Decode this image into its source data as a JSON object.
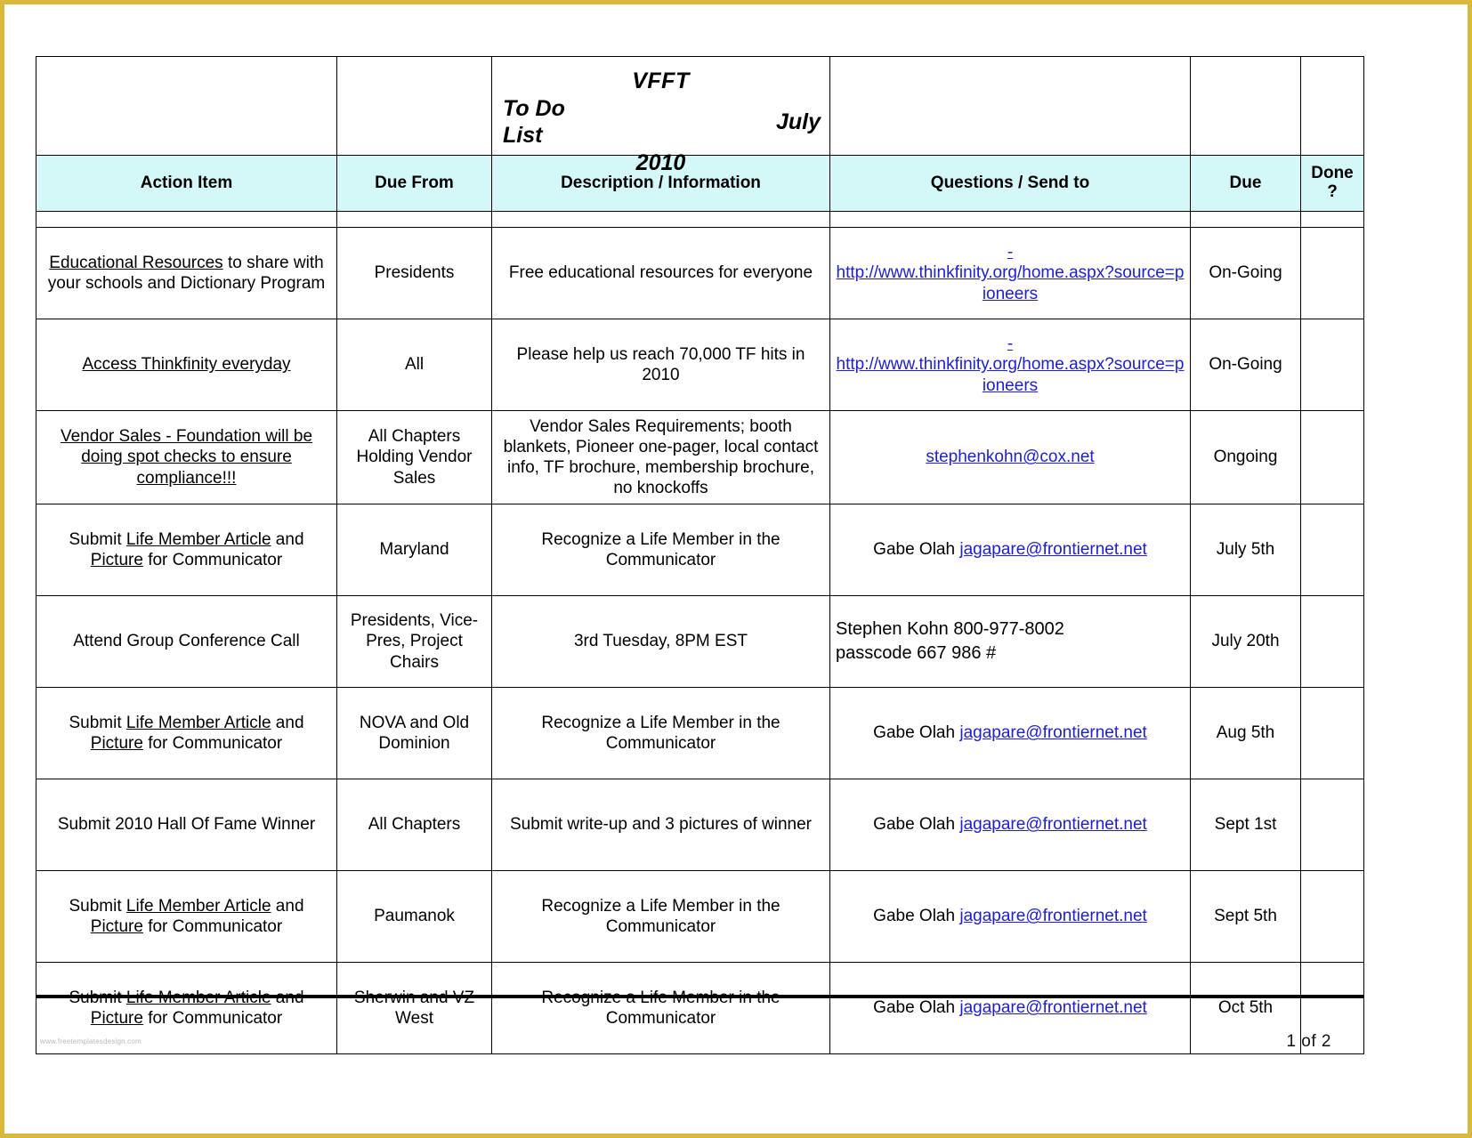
{
  "document": {
    "org": "VFFT",
    "doc_title": "To Do List",
    "month": "July",
    "year": "2010"
  },
  "columns": {
    "action_item": "Action Item",
    "due_from": "Due From",
    "description": "Description / Information",
    "questions": "Questions / Send to",
    "due": "Due",
    "done": "Done ?"
  },
  "links": {
    "thinkfinity_lead": "-",
    "thinkfinity_url": "http://www.thinkfinity.org/home.aspx?source=pioneers",
    "stephen_email": "stephenkohn@cox.net",
    "gabe_email": "jagapare@frontiernet.net"
  },
  "rows": [
    {
      "action_underlined": "Educational Resources",
      "action_rest": " to share with your schools and Dictionary Program",
      "due_from": "Presidents",
      "description": "Free educational resources for everyone",
      "questions_kind": "url",
      "questions_prefix": "",
      "due": "On-Going",
      "done": ""
    },
    {
      "action_underlined": "Access Thinkfinity everyday",
      "action_rest": "",
      "due_from": "All",
      "description": "Please help us reach 70,000 TF hits in 2010",
      "questions_kind": "url",
      "questions_prefix": "",
      "due": "On-Going",
      "done": ""
    },
    {
      "action_underlined": "Vendor Sales - Foundation will be doing spot checks to ensure compliance!!!",
      "action_rest": "",
      "due_from": "All Chapters Holding Vendor Sales",
      "description": "Vendor Sales Requirements; booth blankets, Pioneer one-pager, local contact info, TF brochure, membership brochure, no knockoffs",
      "questions_kind": "email-stephen",
      "questions_prefix": "",
      "due": "Ongoing",
      "done": ""
    },
    {
      "action_pre": "Submit ",
      "action_underlined": "Life Member Article",
      "action_mid": " and ",
      "action_underlined2": "Picture",
      "action_post": " for Communicator",
      "due_from": "Maryland",
      "description": "Recognize a Life Member in the Communicator",
      "questions_kind": "email-gabe",
      "questions_prefix": "Gabe Olah ",
      "due": "July 5th",
      "done": ""
    },
    {
      "action_plain": "Attend Group Conference Call",
      "due_from": "Presidents, Vice-Pres, Project Chairs",
      "description": "3rd Tuesday,  8PM EST",
      "questions_kind": "note",
      "questions_note_line1": "Stephen Kohn  800-977-8002",
      "questions_note_line2": "passcode  667 986 #",
      "due": "July 20th",
      "done": ""
    },
    {
      "action_pre": "Submit ",
      "action_underlined": "Life Member Article",
      "action_mid": " and ",
      "action_underlined2": "Picture",
      "action_post": " for Communicator",
      "due_from": "NOVA and Old Dominion",
      "description": "Recognize a Life Member in the Communicator",
      "questions_kind": "email-gabe",
      "questions_prefix": "Gabe Olah ",
      "due": "Aug 5th",
      "done": ""
    },
    {
      "action_plain": "Submit 2010 Hall Of Fame Winner",
      "due_from": "All Chapters",
      "description": "Submit write-up and 3 pictures of winner",
      "questions_kind": "email-gabe",
      "questions_prefix": "Gabe Olah ",
      "due": "Sept 1st",
      "done": ""
    },
    {
      "action_pre": "Submit ",
      "action_underlined": "Life Member Article",
      "action_mid": " and ",
      "action_underlined2": "Picture",
      "action_post": " for Communicator",
      "due_from": "Paumanok",
      "description": "Recognize a Life Member in the Communicator",
      "questions_kind": "email-gabe",
      "questions_prefix": "Gabe Olah ",
      "due": "Sept 5th",
      "done": ""
    },
    {
      "action_pre": "Submit ",
      "action_underlined": "Life Member Article",
      "action_mid": " and ",
      "action_underlined2": "Picture",
      "action_post": " for Communicator",
      "due_from": "Sherwin and VZ West",
      "description": "Recognize a Life Member in the Communicator",
      "questions_kind": "email-gabe",
      "questions_prefix": "Gabe Olah ",
      "due": "Oct 5th",
      "done": ""
    }
  ],
  "footer": {
    "page_label": "1  of  2",
    "watermark": "www.freetemplatesdesign.com"
  }
}
